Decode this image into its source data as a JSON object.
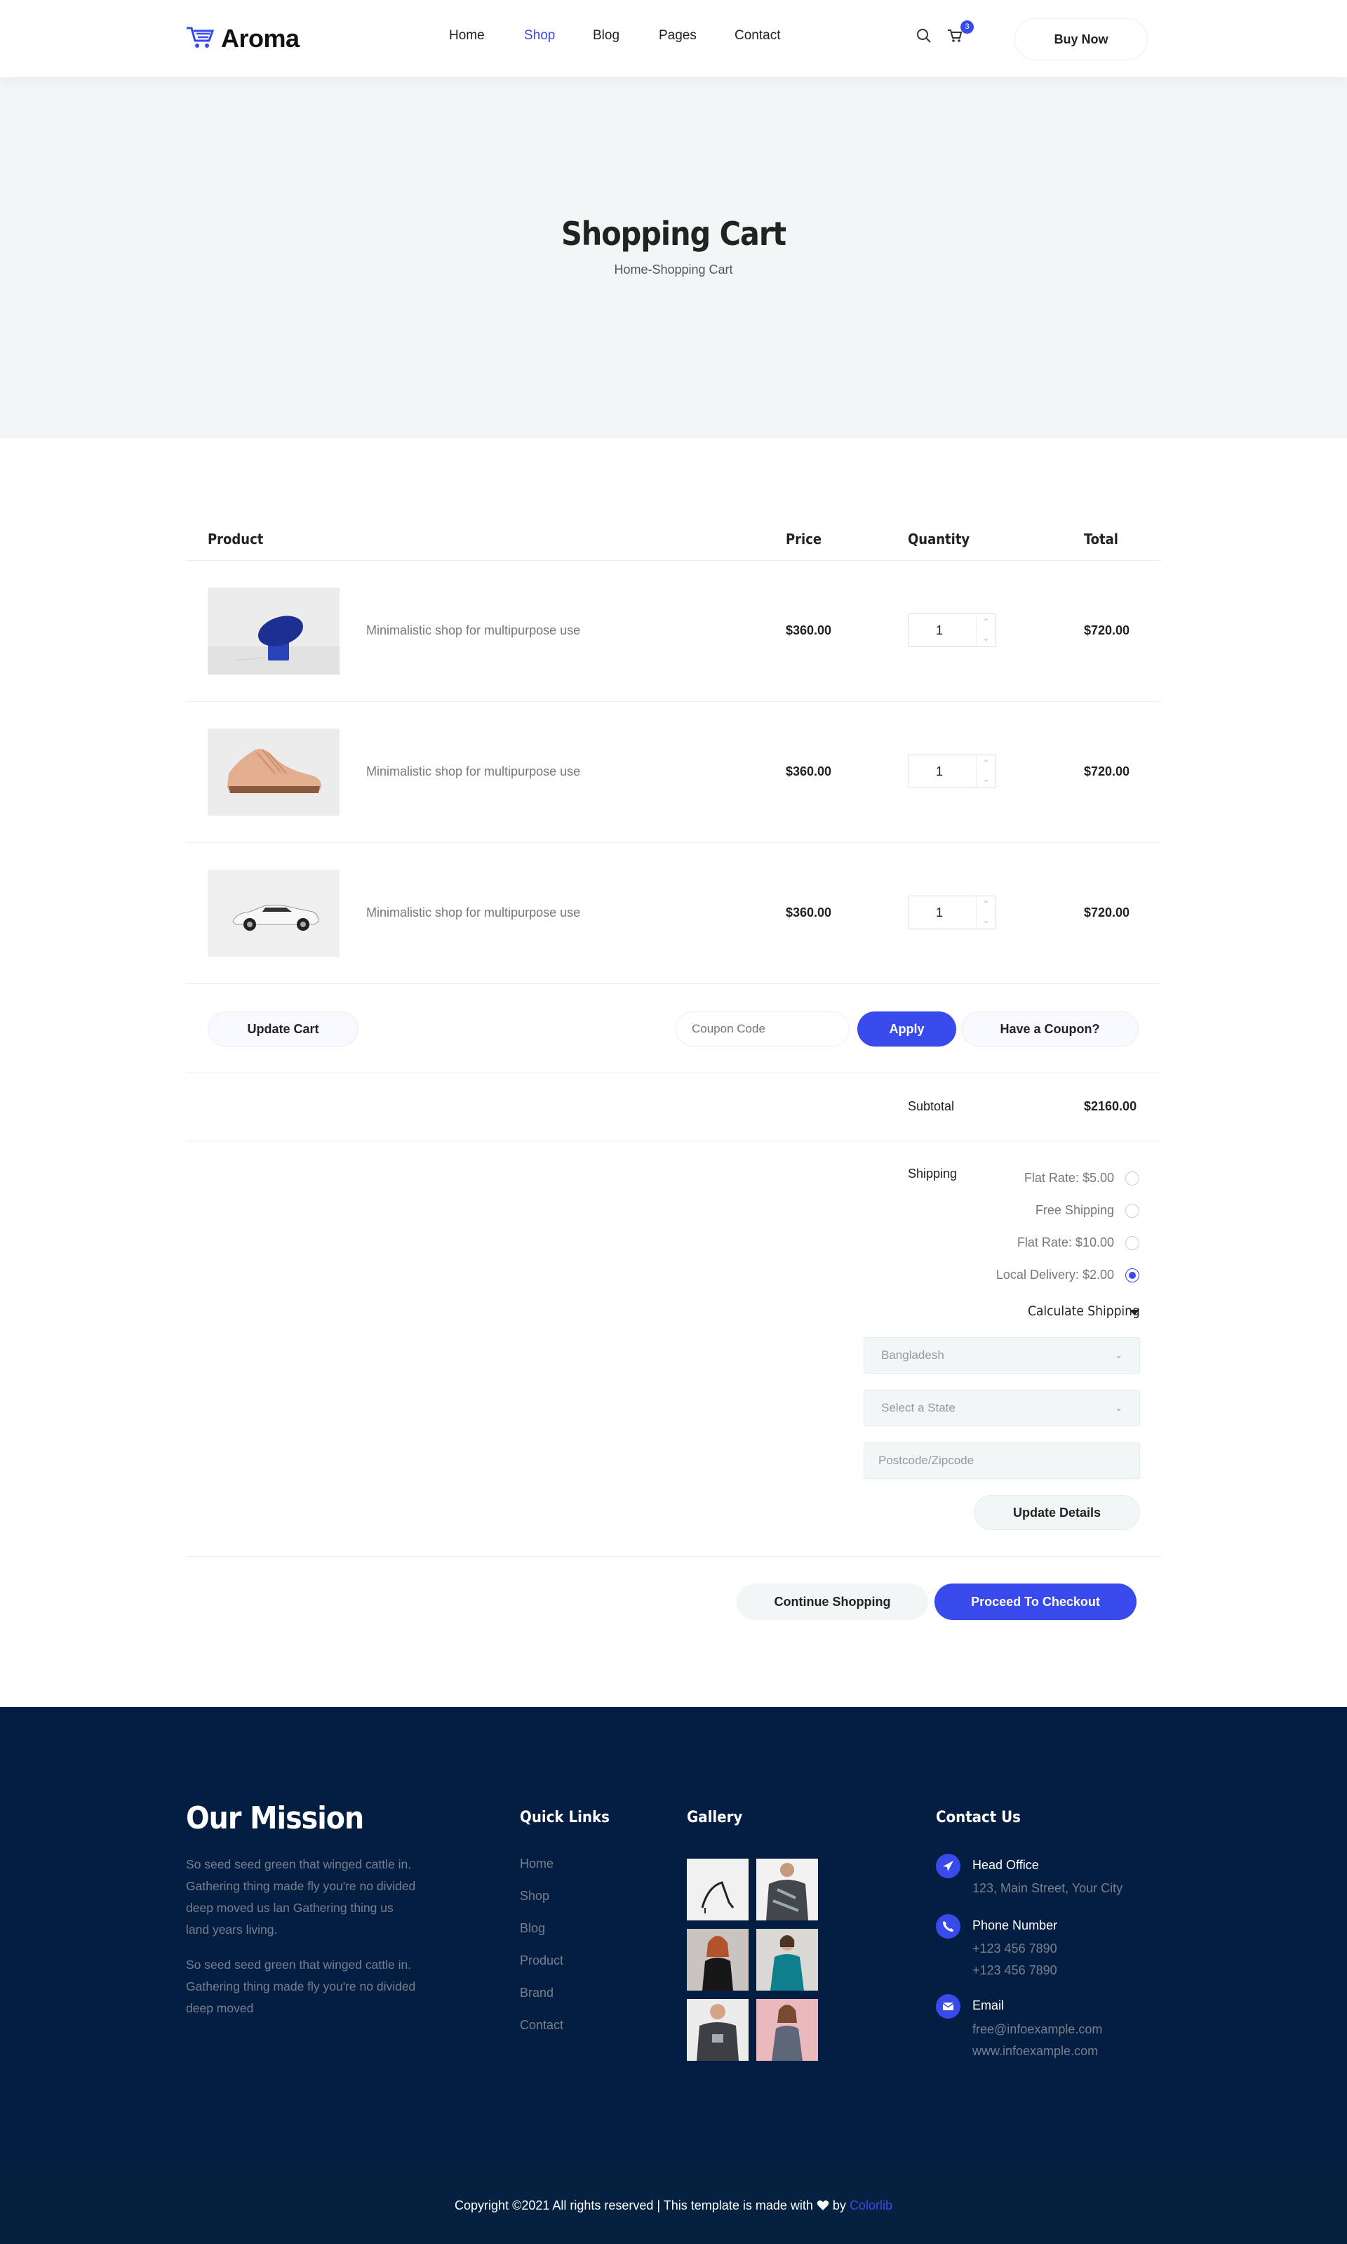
{
  "header": {
    "logo_text": "Aroma",
    "nav": [
      "Home",
      "Shop",
      "Blog",
      "Pages",
      "Contact"
    ],
    "active_nav": "Shop",
    "cart_count": "3",
    "buy_label": "Buy Now"
  },
  "banner": {
    "title": "Shopping Cart",
    "breadcrumb_home": "Home",
    "breadcrumb_sep": "-",
    "breadcrumb_current": "Shopping Cart"
  },
  "table": {
    "headers": [
      "Product",
      "Price",
      "Quantity",
      "Total"
    ],
    "rows": [
      {
        "name": "Minimalistic shop for multipurpose use",
        "price": "$360.00",
        "qty": "1",
        "total": "$720.00",
        "image": "blue-lamp"
      },
      {
        "name": "Minimalistic shop for multipurpose use",
        "price": "$360.00",
        "qty": "1",
        "total": "$720.00",
        "image": "beige-sneaker"
      },
      {
        "name": "Minimalistic shop for multipurpose use",
        "price": "$360.00",
        "qty": "1",
        "total": "$720.00",
        "image": "white-sports-car"
      }
    ]
  },
  "actions": {
    "update_cart": "Update Cart",
    "coupon_placeholder": "Coupon Code",
    "apply": "Apply",
    "have_coupon": "Have a Coupon?"
  },
  "totals": {
    "subtotal_label": "Subtotal",
    "subtotal_value": "$2160.00",
    "shipping_label": "Shipping",
    "shipping_options": [
      {
        "label": "Flat Rate: $5.00",
        "selected": false
      },
      {
        "label": "Free Shipping",
        "selected": false
      },
      {
        "label": "Flat Rate: $10.00",
        "selected": false
      },
      {
        "label": "Local Delivery: $2.00",
        "selected": true
      }
    ],
    "calculate_label": "Calculate Shipping",
    "country": "Bangladesh",
    "state_placeholder": "Select a State",
    "postcode_placeholder": "Postcode/Zipcode",
    "update_details": "Update Details"
  },
  "checkout": {
    "continue": "Continue Shopping",
    "proceed": "Proceed To Checkout"
  },
  "footer": {
    "mission_title": "Our Mission",
    "mission_p1": "So seed seed green that winged cattle in. Gathering thing made fly you're no divided deep moved us lan Gathering thing us land years living.",
    "mission_p2": "So seed seed green that winged cattle in. Gathering thing made fly you're no divided deep moved",
    "quick_links_title": "Quick Links",
    "quick_links": [
      "Home",
      "Shop",
      "Blog",
      "Product",
      "Brand",
      "Contact"
    ],
    "gallery_title": "Gallery",
    "contact_title": "Contact Us",
    "head_office_title": "Head Office",
    "head_office_line": "123, Main Street, Your City",
    "phone_title": "Phone Number",
    "phone_1": "+123 456 7890",
    "phone_2": "+123 456 7890",
    "email_title": "Email",
    "email_1": "free@infoexample.com",
    "email_2": "www.infoexample.com",
    "copyright_pre": "Copyright ©2021 All rights reserved | This template is made with",
    "copyright_by": "by",
    "copyright_link": "Colorlib"
  },
  "colors": {
    "accent": "#384aeb",
    "footer_bg": "#041e42",
    "banner_bg": "#f1f6f7"
  }
}
